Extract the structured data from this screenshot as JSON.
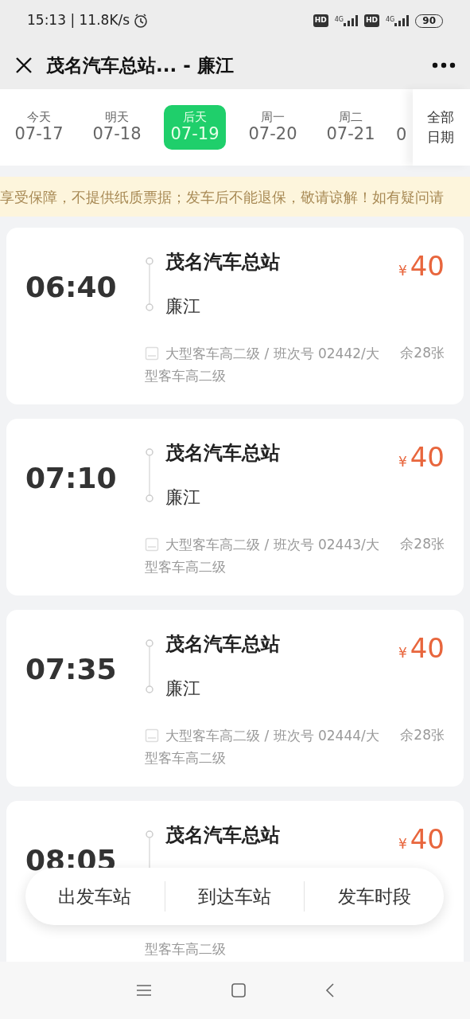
{
  "status_bar": {
    "time": "15:13 | 11.8K/s",
    "sims": [
      {
        "badge": "HD",
        "network": "4G"
      },
      {
        "badge": "HD",
        "network": "4G"
      }
    ],
    "battery": "90"
  },
  "header": {
    "title": "茂名汽车总站... - 廉江"
  },
  "dates": [
    {
      "weekday": "今天",
      "date": "07-17",
      "selected": false
    },
    {
      "weekday": "明天",
      "date": "07-18",
      "selected": false
    },
    {
      "weekday": "后天",
      "date": "07-19",
      "selected": true
    },
    {
      "weekday": "周一",
      "date": "07-20",
      "selected": false
    },
    {
      "weekday": "周二",
      "date": "07-21",
      "selected": false
    },
    {
      "date": "0"
    }
  ],
  "all_dates": [
    "全部",
    "日期"
  ],
  "notice": "享受保障，不提供纸质票据；发车后不能退保，敬请谅解！如有疑问请",
  "trips": [
    {
      "time": "06:40",
      "origin": "茂名汽车总站",
      "destination": "廉江",
      "currency": "¥",
      "price": "40",
      "detail_line1": "大型客车高二级 / 班次号 02442/大",
      "detail_line2": "型客车高二级",
      "seats": "余28张"
    },
    {
      "time": "07:10",
      "origin": "茂名汽车总站",
      "destination": "廉江",
      "currency": "¥",
      "price": "40",
      "detail_line1": "大型客车高二级 / 班次号 02443/大",
      "detail_line2": "型客车高二级",
      "seats": "余28张"
    },
    {
      "time": "07:35",
      "origin": "茂名汽车总站",
      "destination": "廉江",
      "currency": "¥",
      "price": "40",
      "detail_line1": "大型客车高二级 / 班次号 02444/大",
      "detail_line2": "型客车高二级",
      "seats": "余28张"
    },
    {
      "time": "08:05",
      "origin": "茂名汽车总站",
      "currency": "¥",
      "price": "40",
      "detail_line2": "型客车高二级"
    }
  ],
  "filters": [
    "出发车站",
    "到达车站",
    "发车时段"
  ]
}
